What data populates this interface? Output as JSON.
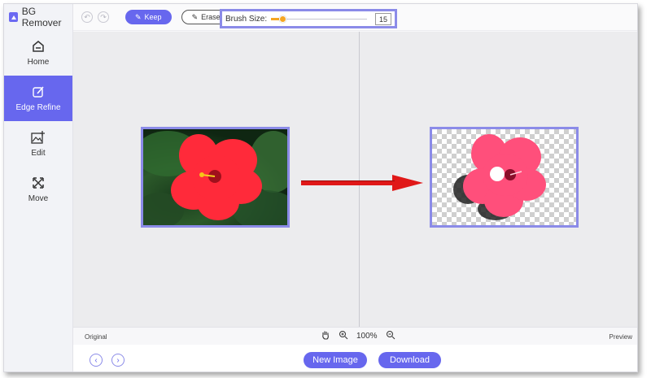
{
  "app": {
    "name": "BG Remover"
  },
  "sidebar": {
    "items": [
      {
        "label": "Home",
        "icon": "home-icon"
      },
      {
        "label": "Edge Refine",
        "icon": "edit-square-icon",
        "active": true
      },
      {
        "label": "Edit",
        "icon": "image-edit-icon"
      },
      {
        "label": "Move",
        "icon": "move-arrows-icon"
      }
    ]
  },
  "toolbar": {
    "keep_label": "Keep",
    "erase_label": "Erase",
    "brush_label": "Brush Size:",
    "brush_size": "15",
    "brush_fraction": 0.12
  },
  "status": {
    "left_label": "Original",
    "right_label": "Preview",
    "zoom": "100%"
  },
  "footer": {
    "new_image_label": "New Image",
    "download_label": "Download"
  },
  "colors": {
    "accent": "#6767ee",
    "highlight_border": "#8b8be8",
    "slider": "#f5a623",
    "arrow": "#e01818"
  }
}
